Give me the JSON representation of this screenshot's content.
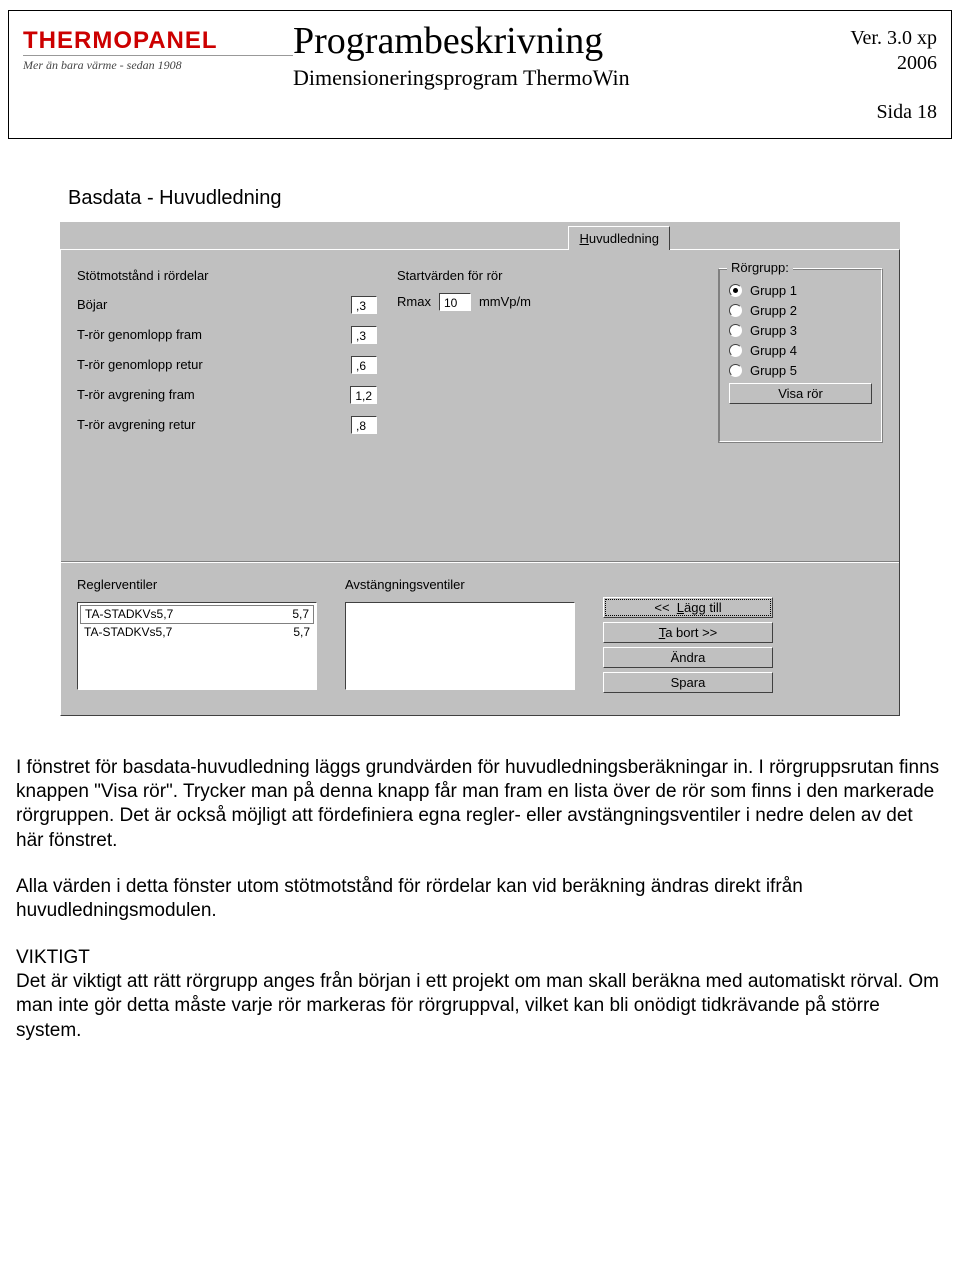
{
  "header": {
    "logo": "THERMOPANEL",
    "tagline": "Mer än bara värme - sedan 1908",
    "title": "Programbeskrivning",
    "subtitle": "Dimensioneringsprogram ThermoWin",
    "version": "Ver. 3.0 xp",
    "year": "2006",
    "page": "Sida 18"
  },
  "section_title": "Basdata - Huvudledning",
  "ui": {
    "tab": "Huvudledning",
    "shock_heading": "Stötmotstånd i rördelar",
    "fields": [
      {
        "label": "Böjar",
        "value": ",3"
      },
      {
        "label": "T-rör genomlopp fram",
        "value": ",3"
      },
      {
        "label": "T-rör genomlopp retur",
        "value": ",6"
      },
      {
        "label": "T-rör avgrening fram",
        "value": "1,2"
      },
      {
        "label": "T-rör avgrening retur",
        "value": ",8"
      }
    ],
    "start_heading": "Startvärden för rör",
    "rmax_label": "Rmax",
    "rmax_value": "10",
    "rmax_unit": "mmVp/m",
    "group_legend": "Rörgrupp:",
    "groups": [
      "Grupp 1",
      "Grupp 2",
      "Grupp 3",
      "Grupp 4",
      "Grupp 5"
    ],
    "group_selected": 0,
    "show_pipes_btn": "Visa rör",
    "reg_heading": "Reglerventiler",
    "reg_items": [
      {
        "name": "TA-STADKVs5,7",
        "val": "5,7"
      },
      {
        "name": "TA-STADKVs5,7",
        "val": "5,7"
      }
    ],
    "shut_heading": "Avstängningsventiler",
    "btn_add": "<<  Lägg till",
    "btn_remove": "Ta bort >>",
    "btn_edit": "Ändra",
    "btn_save": "Spara"
  },
  "body": {
    "p1": "I fönstret för basdata-huvudledning läggs grundvärden för huvudledningsberäkningar in. I rörgruppsrutan finns knappen \"Visa rör\". Trycker man på denna knapp får man fram en lista över de rör som finns i den markerade rörgruppen. Det är också möjligt att fördefiniera egna regler- eller avstängningsventiler i nedre delen av det här fönstret.",
    "p2": "Alla värden i detta fönster utom stötmotstånd för rördelar kan vid beräkning ändras direkt ifrån huvudledningsmodulen.",
    "p3_heading": "VIKTIGT",
    "p3": "Det är viktigt att rätt rörgrupp anges från början i ett projekt om man skall beräkna med automatiskt rörval. Om man inte gör detta måste varje rör markeras för rörgruppval, vilket kan bli onödigt tidkrävande på större system."
  }
}
